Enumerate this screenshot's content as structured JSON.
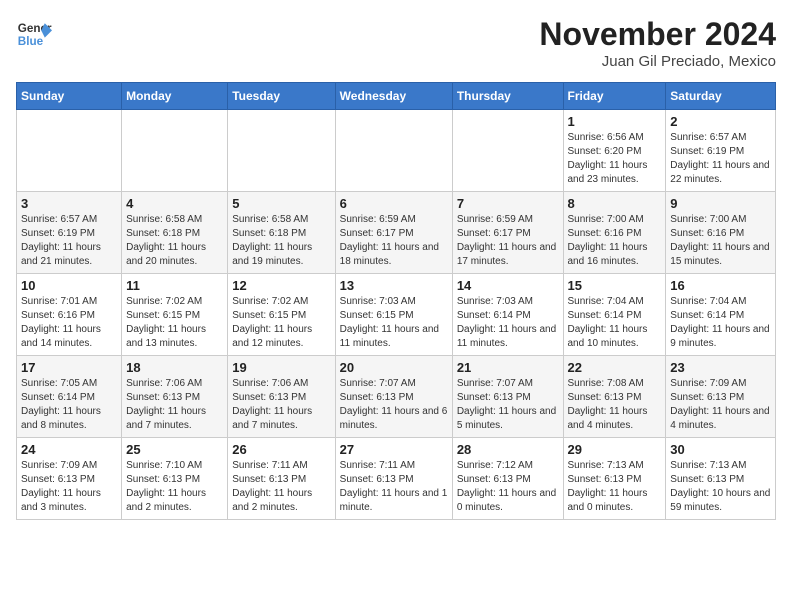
{
  "logo": {
    "line1": "General",
    "line2": "Blue"
  },
  "title": "November 2024",
  "location": "Juan Gil Preciado, Mexico",
  "weekdays": [
    "Sunday",
    "Monday",
    "Tuesday",
    "Wednesday",
    "Thursday",
    "Friday",
    "Saturday"
  ],
  "weeks": [
    [
      {
        "day": "",
        "info": ""
      },
      {
        "day": "",
        "info": ""
      },
      {
        "day": "",
        "info": ""
      },
      {
        "day": "",
        "info": ""
      },
      {
        "day": "",
        "info": ""
      },
      {
        "day": "1",
        "info": "Sunrise: 6:56 AM\nSunset: 6:20 PM\nDaylight: 11 hours and 23 minutes."
      },
      {
        "day": "2",
        "info": "Sunrise: 6:57 AM\nSunset: 6:19 PM\nDaylight: 11 hours and 22 minutes."
      }
    ],
    [
      {
        "day": "3",
        "info": "Sunrise: 6:57 AM\nSunset: 6:19 PM\nDaylight: 11 hours and 21 minutes."
      },
      {
        "day": "4",
        "info": "Sunrise: 6:58 AM\nSunset: 6:18 PM\nDaylight: 11 hours and 20 minutes."
      },
      {
        "day": "5",
        "info": "Sunrise: 6:58 AM\nSunset: 6:18 PM\nDaylight: 11 hours and 19 minutes."
      },
      {
        "day": "6",
        "info": "Sunrise: 6:59 AM\nSunset: 6:17 PM\nDaylight: 11 hours and 18 minutes."
      },
      {
        "day": "7",
        "info": "Sunrise: 6:59 AM\nSunset: 6:17 PM\nDaylight: 11 hours and 17 minutes."
      },
      {
        "day": "8",
        "info": "Sunrise: 7:00 AM\nSunset: 6:16 PM\nDaylight: 11 hours and 16 minutes."
      },
      {
        "day": "9",
        "info": "Sunrise: 7:00 AM\nSunset: 6:16 PM\nDaylight: 11 hours and 15 minutes."
      }
    ],
    [
      {
        "day": "10",
        "info": "Sunrise: 7:01 AM\nSunset: 6:16 PM\nDaylight: 11 hours and 14 minutes."
      },
      {
        "day": "11",
        "info": "Sunrise: 7:02 AM\nSunset: 6:15 PM\nDaylight: 11 hours and 13 minutes."
      },
      {
        "day": "12",
        "info": "Sunrise: 7:02 AM\nSunset: 6:15 PM\nDaylight: 11 hours and 12 minutes."
      },
      {
        "day": "13",
        "info": "Sunrise: 7:03 AM\nSunset: 6:15 PM\nDaylight: 11 hours and 11 minutes."
      },
      {
        "day": "14",
        "info": "Sunrise: 7:03 AM\nSunset: 6:14 PM\nDaylight: 11 hours and 11 minutes."
      },
      {
        "day": "15",
        "info": "Sunrise: 7:04 AM\nSunset: 6:14 PM\nDaylight: 11 hours and 10 minutes."
      },
      {
        "day": "16",
        "info": "Sunrise: 7:04 AM\nSunset: 6:14 PM\nDaylight: 11 hours and 9 minutes."
      }
    ],
    [
      {
        "day": "17",
        "info": "Sunrise: 7:05 AM\nSunset: 6:14 PM\nDaylight: 11 hours and 8 minutes."
      },
      {
        "day": "18",
        "info": "Sunrise: 7:06 AM\nSunset: 6:13 PM\nDaylight: 11 hours and 7 minutes."
      },
      {
        "day": "19",
        "info": "Sunrise: 7:06 AM\nSunset: 6:13 PM\nDaylight: 11 hours and 7 minutes."
      },
      {
        "day": "20",
        "info": "Sunrise: 7:07 AM\nSunset: 6:13 PM\nDaylight: 11 hours and 6 minutes."
      },
      {
        "day": "21",
        "info": "Sunrise: 7:07 AM\nSunset: 6:13 PM\nDaylight: 11 hours and 5 minutes."
      },
      {
        "day": "22",
        "info": "Sunrise: 7:08 AM\nSunset: 6:13 PM\nDaylight: 11 hours and 4 minutes."
      },
      {
        "day": "23",
        "info": "Sunrise: 7:09 AM\nSunset: 6:13 PM\nDaylight: 11 hours and 4 minutes."
      }
    ],
    [
      {
        "day": "24",
        "info": "Sunrise: 7:09 AM\nSunset: 6:13 PM\nDaylight: 11 hours and 3 minutes."
      },
      {
        "day": "25",
        "info": "Sunrise: 7:10 AM\nSunset: 6:13 PM\nDaylight: 11 hours and 2 minutes."
      },
      {
        "day": "26",
        "info": "Sunrise: 7:11 AM\nSunset: 6:13 PM\nDaylight: 11 hours and 2 minutes."
      },
      {
        "day": "27",
        "info": "Sunrise: 7:11 AM\nSunset: 6:13 PM\nDaylight: 11 hours and 1 minute."
      },
      {
        "day": "28",
        "info": "Sunrise: 7:12 AM\nSunset: 6:13 PM\nDaylight: 11 hours and 0 minutes."
      },
      {
        "day": "29",
        "info": "Sunrise: 7:13 AM\nSunset: 6:13 PM\nDaylight: 11 hours and 0 minutes."
      },
      {
        "day": "30",
        "info": "Sunrise: 7:13 AM\nSunset: 6:13 PM\nDaylight: 10 hours and 59 minutes."
      }
    ]
  ]
}
